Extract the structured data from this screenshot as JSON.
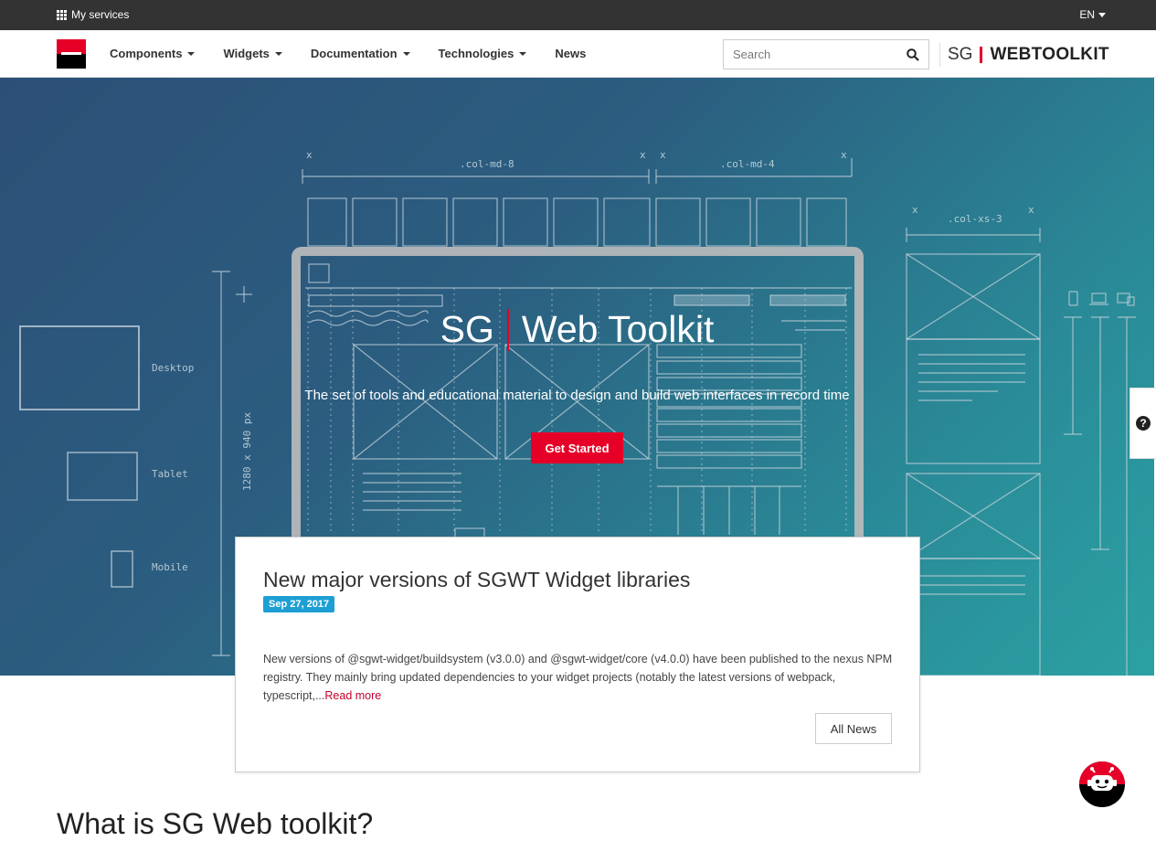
{
  "topbar": {
    "services_label": "My services",
    "lang_label": "EN"
  },
  "navbar": {
    "items": [
      {
        "label": "Components",
        "dropdown": true
      },
      {
        "label": "Widgets",
        "dropdown": true
      },
      {
        "label": "Documentation",
        "dropdown": true
      },
      {
        "label": "Technologies",
        "dropdown": true
      },
      {
        "label": "News",
        "dropdown": false
      }
    ],
    "search_placeholder": "Search",
    "brand_sg": "SG",
    "brand_name": "WEBTOOLKIT"
  },
  "hero": {
    "title_left": "SG",
    "title_right": "Web Toolkit",
    "subtitle": "The set of tools and educational material to design and build web interfaces in record time",
    "cta_label": "Get Started",
    "illustration": {
      "col_md_8": ".col-md-8",
      "col_md_4": ".col-md-4",
      "col_xs_3": ".col-xs-3",
      "dimension": "1280 x 940 px",
      "desktop": "Desktop",
      "tablet": "Tablet",
      "mobile": "Mobile",
      "x": "x"
    }
  },
  "news": {
    "title": "New major versions of SGWT Widget libraries",
    "date": "Sep 27, 2017",
    "body": "New versions of @sgwt-widget/buildsystem (v3.0.0) and @sgwt-widget/core (v4.0.0) have been published to the nexus NPM registry.   They mainly bring updated dependencies to your widget projects (notably the latest versions of webpack, typescript,...",
    "read_more": "Read more",
    "all_news_label": "All News"
  },
  "section": {
    "heading": "What is SG Web toolkit?"
  },
  "help": {
    "label": "?"
  },
  "colors": {
    "brand_red": "#e60028",
    "date_badge": "#1e9fd4",
    "topbar": "#333333"
  }
}
